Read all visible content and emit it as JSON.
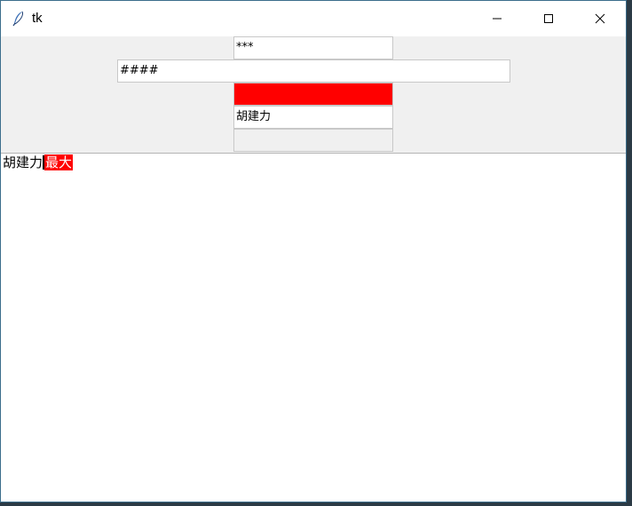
{
  "window": {
    "title": "tk",
    "icon": "feather-icon",
    "controls": [
      "minimize-icon",
      "maximize-icon",
      "close-icon"
    ]
  },
  "entries": {
    "entry1_value": "***",
    "entry2_value": "####",
    "entry3_value": "",
    "entry3_bg": "#ff0000",
    "entry4_value": "胡建力",
    "entry5_value": ""
  },
  "textbox": {
    "plain_text": "胡建力",
    "highlighted_text": "最大",
    "highlight_bg": "#ff0000",
    "highlight_fg": "#ffffff"
  }
}
